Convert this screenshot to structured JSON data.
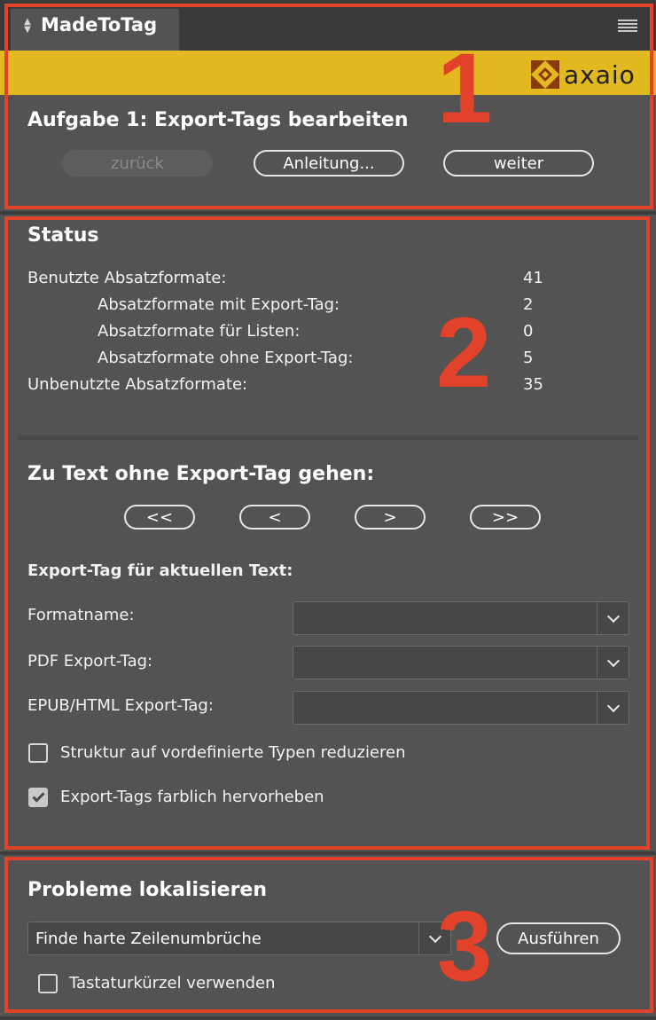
{
  "panel": {
    "title": "MadeToTag"
  },
  "brand": {
    "logo_text": "axaio",
    "bar_color": "#e2b920"
  },
  "annotations": {
    "n1": "1",
    "n2": "2",
    "n3": "3",
    "color": "#e2412a"
  },
  "task": {
    "title": "Aufgabe 1: Export-Tags bearbeiten",
    "back_label": "zurück",
    "guide_label": "Anleitung...",
    "next_label": "weiter"
  },
  "status": {
    "title": "Status",
    "rows": [
      {
        "label": "Benutzte Absatzformate:",
        "value": "41"
      },
      {
        "label": "Absatzformate mit Export-Tag:",
        "value": "2"
      },
      {
        "label": "Absatzformate für Listen:",
        "value": "0"
      },
      {
        "label": "Absatzformate ohne Export-Tag:",
        "value": "5"
      },
      {
        "label": "Unbenutzte Absatzformate:",
        "value": "35"
      }
    ]
  },
  "navigate": {
    "title": "Zu Text ohne Export-Tag gehen:",
    "first": "<<",
    "prev": "<",
    "next": ">",
    "last": ">>"
  },
  "export_tag": {
    "title": "Export-Tag für aktuellen Text:",
    "format_label": "Formatname:",
    "format_value": "",
    "pdf_label": "PDF Export-Tag:",
    "pdf_value": "",
    "epub_label": "EPUB/HTML Export-Tag:",
    "epub_value": "",
    "reduce_label": "Struktur auf vordefinierte Typen reduzieren",
    "reduce_checked": false,
    "highlight_label": "Export-Tags farblich hervorheben",
    "highlight_checked": true
  },
  "problems": {
    "title": "Probleme lokalisieren",
    "selected": "Finde harte Zeilenumbrüche",
    "run_label": "Ausführen",
    "shortcut_label": "Tastaturkürzel verwenden",
    "shortcut_checked": false
  }
}
